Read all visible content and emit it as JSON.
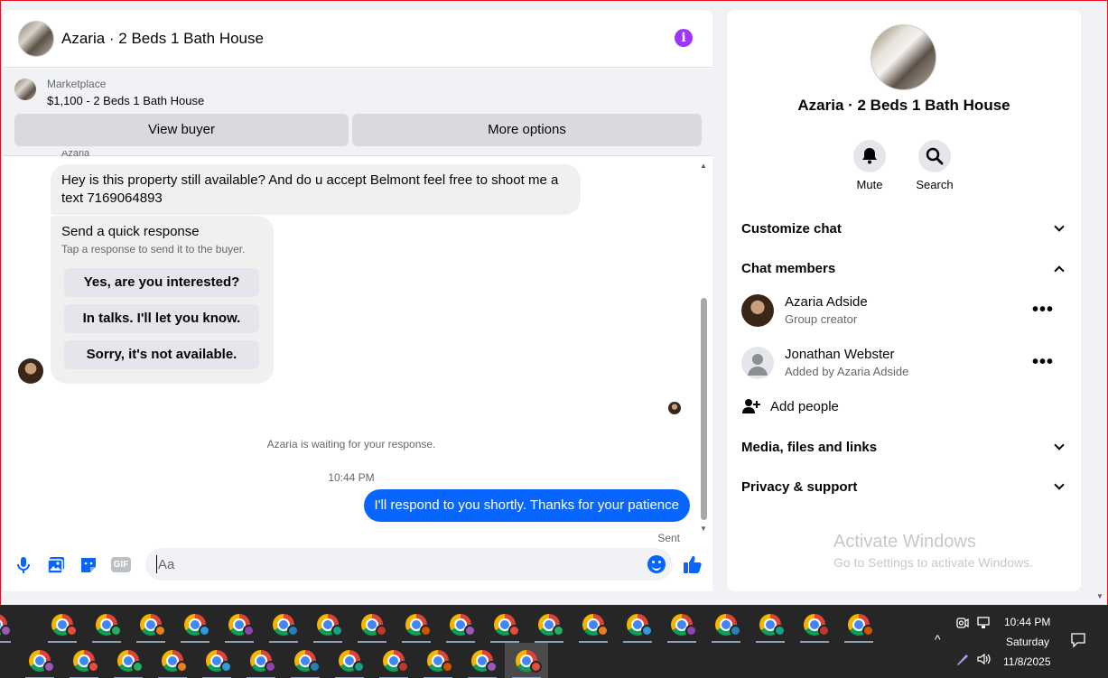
{
  "chat": {
    "title": "Azaria · 2 Beds 1 Bath House",
    "marketplace_label": "Marketplace",
    "listing": "$1,100 - 2 Beds 1 Bath House",
    "view_buyer": "View buyer",
    "more_options": "More options",
    "sender_peek": "Azaria",
    "incoming_message": "Hey is this property still available? And do u accept Belmont feel free to shoot me a text 7169064893",
    "quick_response": {
      "title": "Send a quick response",
      "subtitle": "Tap a response to send it to the buyer.",
      "options": [
        "Yes, are you interested?",
        "In talks. I'll let you know.",
        "Sorry, it's not available."
      ]
    },
    "waiting_notice": "Azaria is waiting for your response.",
    "timestamp": "10:44 PM",
    "outgoing_message": "I'll respond to you shortly. Thanks for your patience",
    "status": "Sent",
    "composer_placeholder": "Aa",
    "gif_label": "GIF"
  },
  "details": {
    "title": "Azaria · 2 Beds 1 Bath House",
    "actions": [
      {
        "label": "Mute",
        "icon": "bell-icon"
      },
      {
        "label": "Search",
        "icon": "search-icon"
      }
    ],
    "sections": {
      "customize": "Customize chat",
      "members": "Chat members",
      "media": "Media, files and links",
      "privacy": "Privacy & support"
    },
    "members": [
      {
        "name": "Azaria Adside",
        "role": "Group creator"
      },
      {
        "name": "Jonathan Webster",
        "role": "Added by Azaria Adside"
      }
    ],
    "add_people": "Add people",
    "watermark_title": "Activate Windows",
    "watermark_sub": "Go to Settings to activate Windows."
  },
  "taskbar": {
    "time": "10:44 PM",
    "day": "Saturday",
    "date": "11/8/2025"
  },
  "colors": {
    "messenger_blue": "#0866ff",
    "info_purple": "#a033ff",
    "taskbar_bg": "#262626"
  }
}
